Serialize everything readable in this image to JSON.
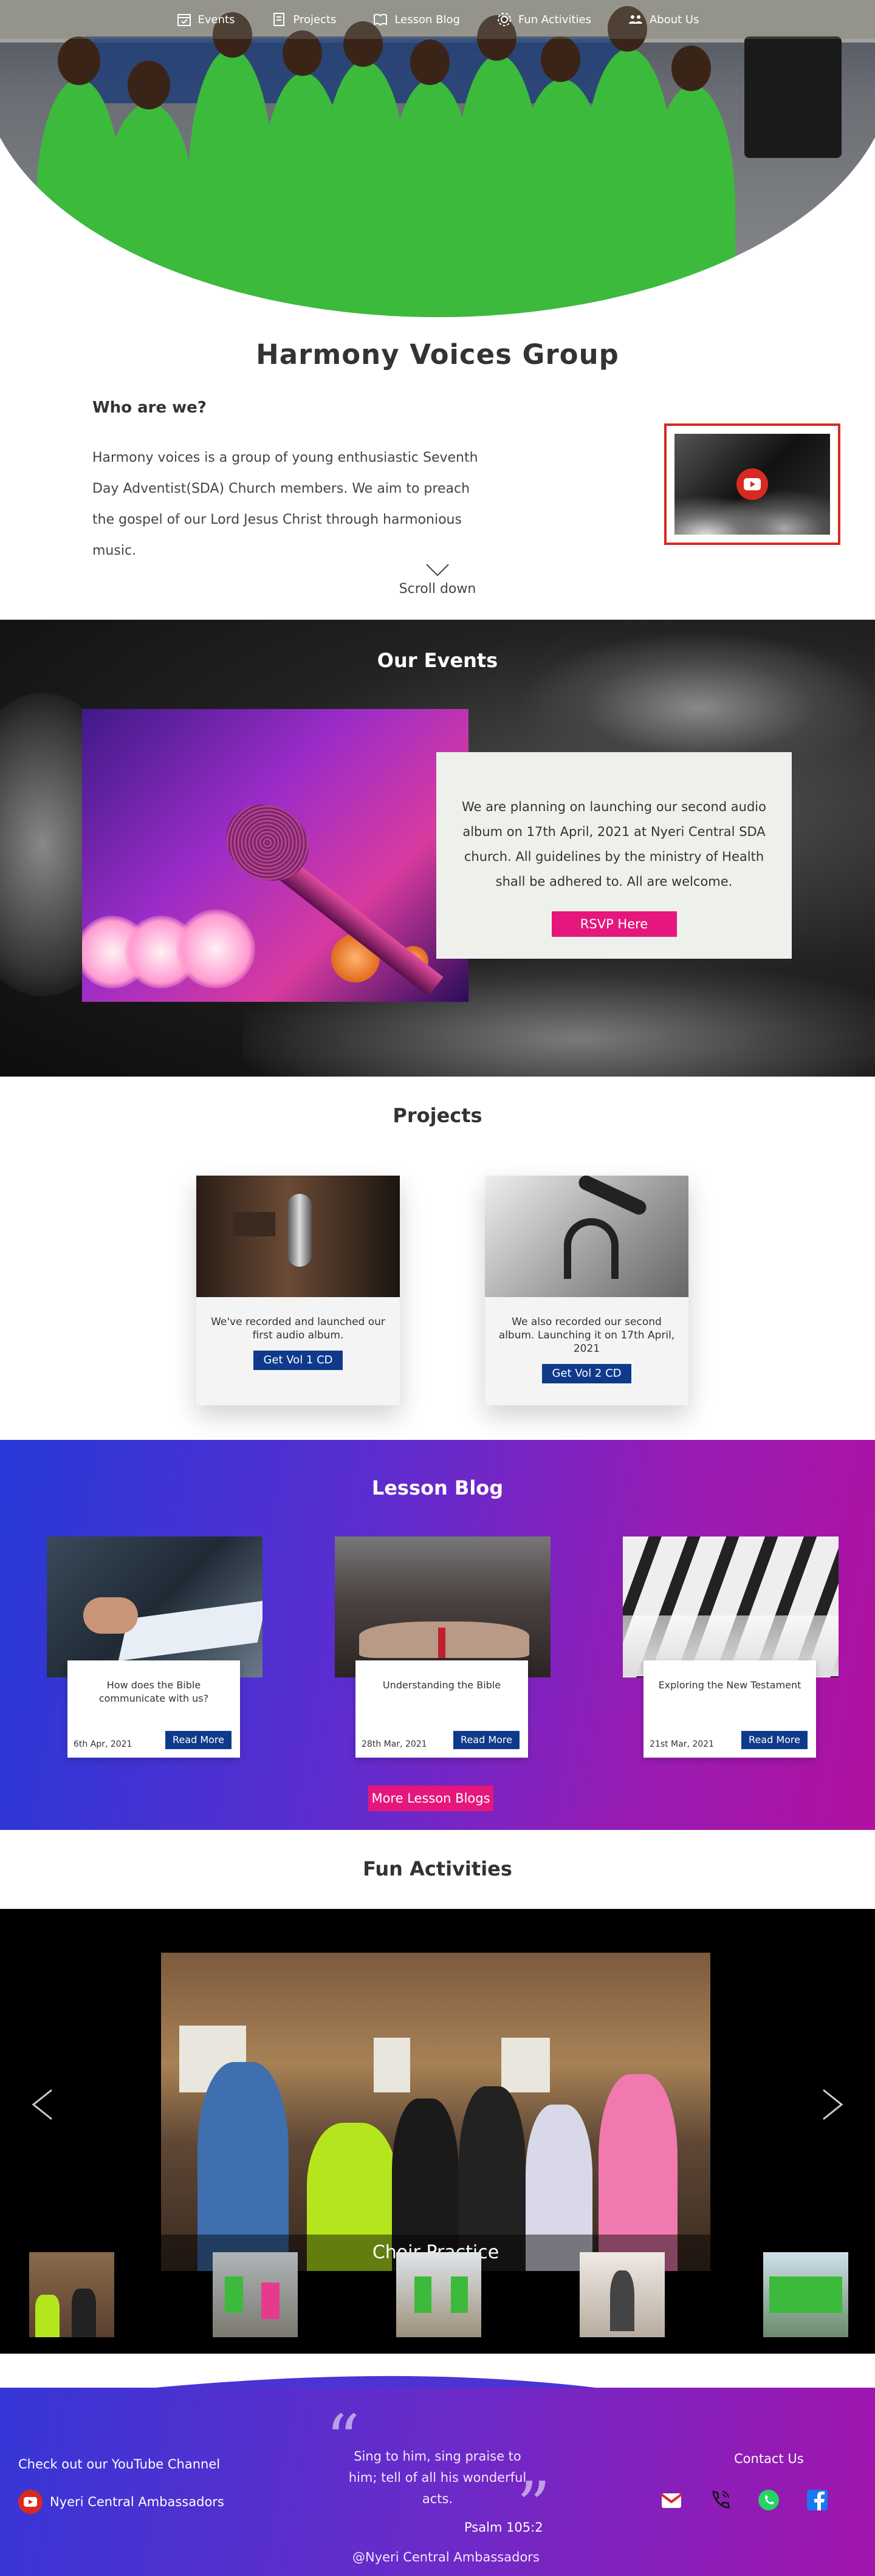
{
  "nav": {
    "items": [
      {
        "label": "Events",
        "icon": "calendar-icon"
      },
      {
        "label": "Projects",
        "icon": "notebook-icon"
      },
      {
        "label": "Lesson Blog",
        "icon": "book-icon"
      },
      {
        "label": "Fun Activities",
        "icon": "gear-icon"
      },
      {
        "label": "About Us",
        "icon": "people-icon"
      }
    ]
  },
  "hero": {
    "title": "Harmony Voices Group",
    "who_heading": "Who are we?",
    "about": "Harmony voices is a group of young enthusiastic Seventh Day Adventist(SDA) Church members. We aim to preach the gospel of our Lord Jesus Christ through harmonious music.",
    "scroll_label": "Scroll down"
  },
  "events": {
    "title": "Our Events",
    "text": "We are planning on launching our second audio album on 17th April, 2021 at Nyeri Central SDA church. All guidelines by the ministry of Health shall be adhered to. All are welcome.",
    "rsvp_label": "RSVP Here"
  },
  "projects": {
    "title": "Projects",
    "cards": [
      {
        "text": "We've recorded and launched our first audio album.",
        "button": "Get Vol 1 CD"
      },
      {
        "text": "We also recorded our second album. Launching it on 17th April, 2021",
        "button": "Get Vol 2 CD"
      }
    ]
  },
  "blog": {
    "title": "Lesson Blog",
    "posts": [
      {
        "title": "How does the Bible communicate with us?",
        "date": "6th Apr, 2021",
        "button": "Read More"
      },
      {
        "title": "Understanding the Bible",
        "date": "28th Mar, 2021",
        "button": "Read More"
      },
      {
        "title": "Exploring the New Testament",
        "date": "21st Mar, 2021",
        "button": "Read More"
      }
    ],
    "more_label": "More Lesson Blogs"
  },
  "fun": {
    "title": "Fun Activities",
    "caption": "Choir Practice"
  },
  "footer": {
    "youtube_heading": "Check out our YouTube Channel",
    "youtube_channel": "Nyeri Central Ambassadors",
    "verse": "Sing to him, sing praise to him; tell of all his wonderful acts.",
    "verse_ref": "Psalm 105:2",
    "handle": "@Nyeri Central Ambassadors",
    "contact_heading": "Contact Us"
  },
  "colors": {
    "accent_pink": "#e5177c",
    "button_blue": "#0f3a8c",
    "youtube_red": "#d92a21"
  }
}
